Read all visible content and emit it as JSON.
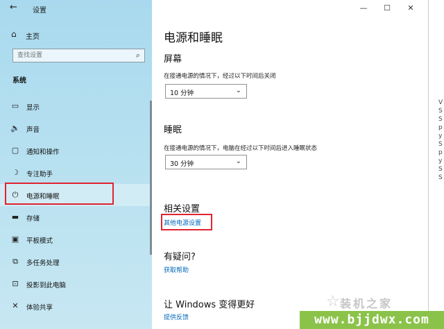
{
  "window": {
    "title": "设置",
    "back_glyph": "←",
    "controls": [
      "—",
      "☐",
      "✕"
    ]
  },
  "sidebar": {
    "home_label": "主页",
    "search_placeholder": "查找设置",
    "section_label": "系统",
    "items": [
      {
        "label": "显示",
        "icon": "display-icon",
        "glyph": "▭"
      },
      {
        "label": "声音",
        "icon": "speaker-icon",
        "glyph": "🔈"
      },
      {
        "label": "通知和操作",
        "icon": "notification-icon",
        "glyph": "▢"
      },
      {
        "label": "专注助手",
        "icon": "moon-icon",
        "glyph": "☽"
      },
      {
        "label": "电源和睡眠",
        "icon": "power-icon",
        "glyph": "⏻"
      },
      {
        "label": "存储",
        "icon": "storage-icon",
        "glyph": "▬"
      },
      {
        "label": "平板模式",
        "icon": "tablet-icon",
        "glyph": "▣"
      },
      {
        "label": "多任务处理",
        "icon": "multitask-icon",
        "glyph": "⧉"
      },
      {
        "label": "投影到此电脑",
        "icon": "project-icon",
        "glyph": "⊡"
      },
      {
        "label": "体验共享",
        "icon": "share-icon",
        "glyph": "✕"
      }
    ]
  },
  "main": {
    "page_title": "电源和睡眠",
    "screen": {
      "heading": "屏幕",
      "desc": "在接通电源的情况下，经过以下时间后关闭",
      "value": "10 分钟"
    },
    "sleep": {
      "heading": "睡眠",
      "desc": "在接通电源的情况下，电脑在经过以下时间后进入睡眠状态",
      "value": "30 分钟"
    },
    "related": {
      "heading": "相关设置",
      "link": "其他电源设置"
    },
    "question": {
      "heading": "有疑问?",
      "link": "获取帮助"
    },
    "improve": {
      "heading": "让 Windows 变得更好",
      "link": "提供反馈"
    }
  },
  "watermark": {
    "text": "装机之家",
    "url": "www.bjjdwx.com"
  },
  "desktop_fragments": [
    "V",
    "S",
    "S",
    "p",
    "y",
    "S",
    "p",
    "y",
    "S",
    "S"
  ],
  "colors": {
    "accent_link": "#0067b8",
    "highlight": "#e0232f",
    "sidebar_bg": "#b6e0f0"
  }
}
